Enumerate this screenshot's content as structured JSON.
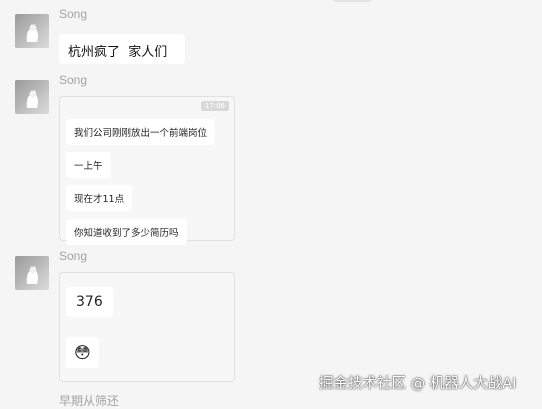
{
  "messages": [
    {
      "sender": "Song",
      "text": "杭州疯了  家人们"
    },
    {
      "sender": "Song",
      "forward_time": "17:06",
      "lines": [
        "我们公司刚刚放出一个前端岗位",
        "一上午",
        "现在才11点",
        "你知道收到了多少简历吗"
      ]
    },
    {
      "sender": "Song",
      "lines": [
        "376"
      ],
      "emoji": "😳"
    }
  ],
  "partial_next_label": "早期从筛还",
  "watermark": "掘金技术社区 @ 机器人大战AI",
  "avatar_icon": "cat-icon"
}
